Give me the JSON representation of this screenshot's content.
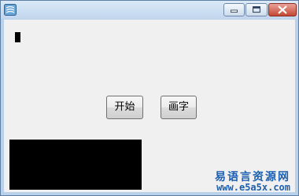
{
  "window": {
    "icon": "app-icon",
    "controls": {
      "minimize_icon": "minimize-icon",
      "maximize_icon": "maximize-icon",
      "close_icon": "close-icon"
    }
  },
  "buttons": {
    "start_label": "开始",
    "draw_label": "画字"
  },
  "colors": {
    "watermark": "#1d5fb0",
    "canvas": "#000000",
    "close_button": "#c44734"
  },
  "watermark": {
    "site_name": "易语言资源网",
    "url": "www.e5a5x.com"
  }
}
